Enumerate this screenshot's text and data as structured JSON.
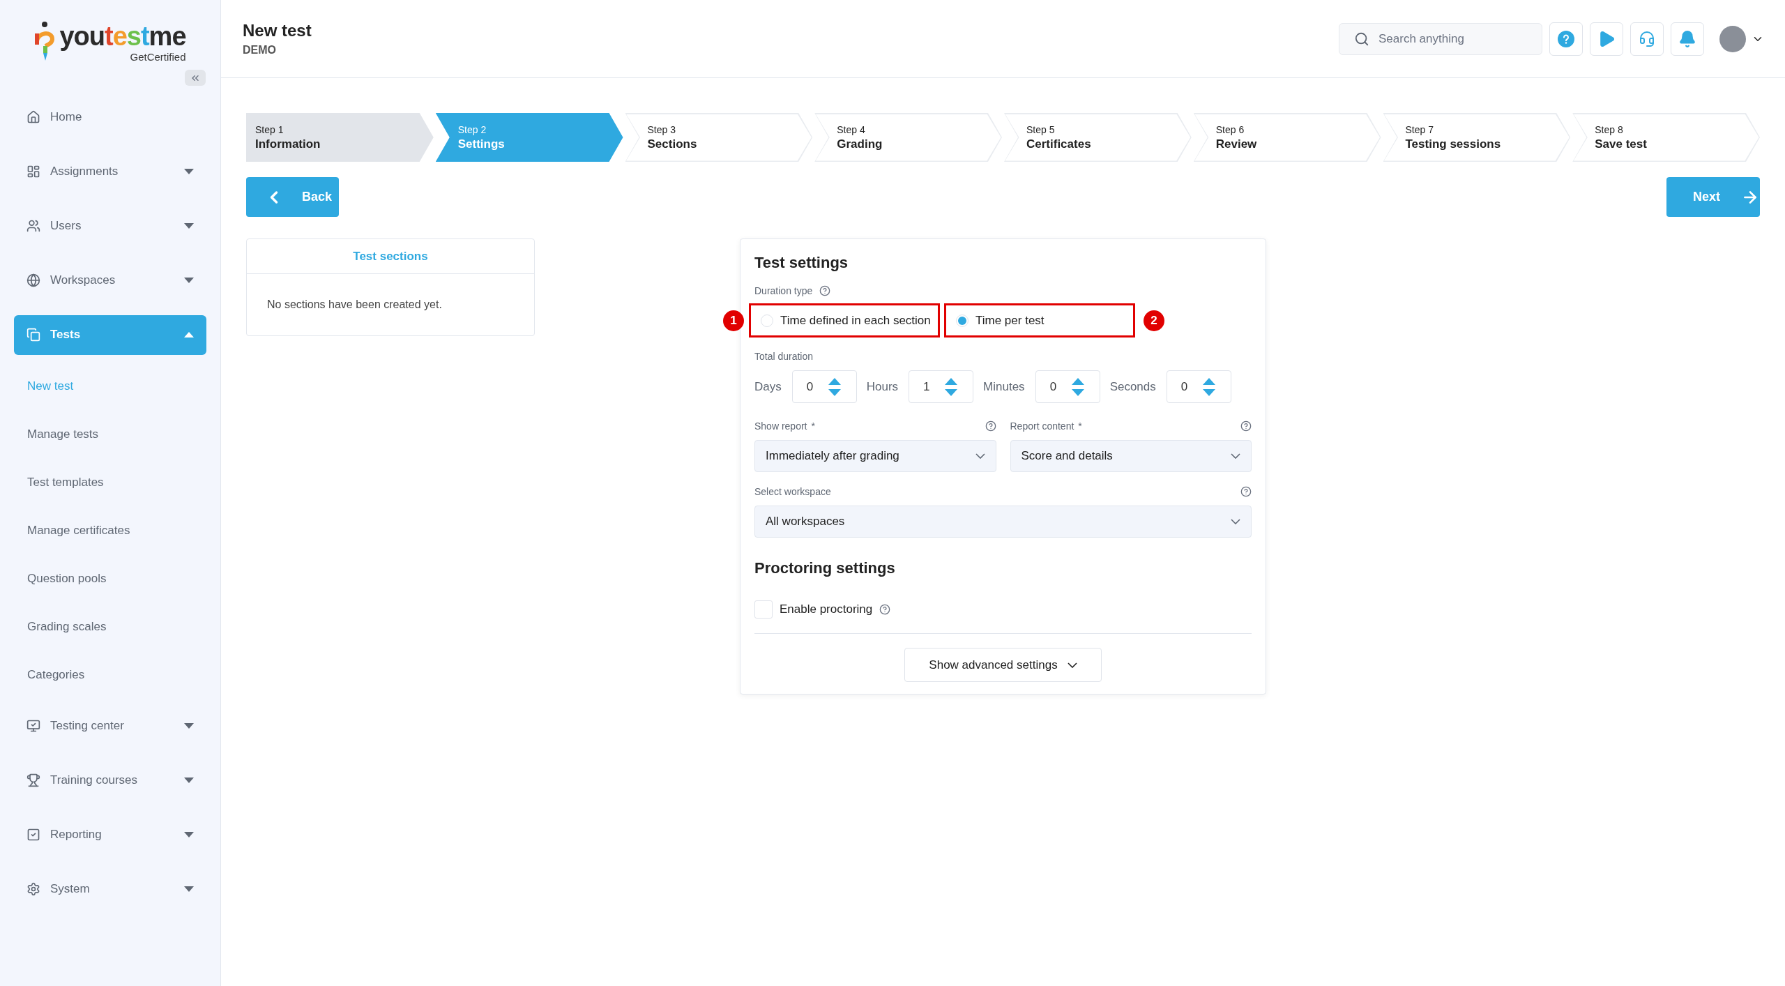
{
  "sidebar": {
    "logo": {
      "wordmark": "youtestme",
      "tagline": "GetCertified"
    },
    "items": [
      {
        "label": "Home",
        "kind": "link",
        "selected": false
      },
      {
        "label": "Assignments",
        "kind": "group",
        "selected": false,
        "expanded": false
      },
      {
        "label": "Users",
        "kind": "group",
        "selected": false,
        "expanded": false
      },
      {
        "label": "Workspaces",
        "kind": "group",
        "selected": false,
        "expanded": false
      },
      {
        "label": "Tests",
        "kind": "group",
        "selected": true,
        "expanded": true,
        "children": [
          {
            "label": "New test",
            "selected": true
          },
          {
            "label": "Manage tests",
            "selected": false
          },
          {
            "label": "Test templates",
            "selected": false
          },
          {
            "label": "Manage certificates",
            "selected": false
          },
          {
            "label": "Question pools",
            "selected": false
          },
          {
            "label": "Grading scales",
            "selected": false
          },
          {
            "label": "Categories",
            "selected": false
          }
        ]
      },
      {
        "label": "Testing center",
        "kind": "group",
        "selected": false,
        "expanded": false
      },
      {
        "label": "Training courses",
        "kind": "group",
        "selected": false,
        "expanded": false
      },
      {
        "label": "Reporting",
        "kind": "group",
        "selected": false,
        "expanded": false
      },
      {
        "label": "System",
        "kind": "group",
        "selected": false,
        "expanded": false
      }
    ]
  },
  "header": {
    "title": "New test",
    "subtitle": "DEMO",
    "search": {
      "placeholder": "Search anything"
    }
  },
  "steps": [
    {
      "step": "Step 1",
      "label": "Information",
      "selected": false,
      "completed": true
    },
    {
      "step": "Step 2",
      "label": "Settings",
      "selected": true,
      "completed": false
    },
    {
      "step": "Step 3",
      "label": "Sections",
      "selected": false,
      "completed": false
    },
    {
      "step": "Step 4",
      "label": "Grading",
      "selected": false,
      "completed": false
    },
    {
      "step": "Step 5",
      "label": "Certificates",
      "selected": false,
      "completed": false
    },
    {
      "step": "Step 6",
      "label": "Review",
      "selected": false,
      "completed": false
    },
    {
      "step": "Step 7",
      "label": "Testing sessions",
      "selected": false,
      "completed": false
    },
    {
      "step": "Step 8",
      "label": "Save test",
      "selected": false,
      "completed": false
    }
  ],
  "buttons": {
    "back": "Back",
    "next": "Next"
  },
  "sections_panel": {
    "tab": "Test sections",
    "empty_message": "No sections have been created yet."
  },
  "settings": {
    "title": "Test settings",
    "duration_type": {
      "label": "Duration type",
      "options": [
        {
          "label": "Time defined in each section",
          "selected": false,
          "callout": "1"
        },
        {
          "label": "Time per test",
          "selected": true,
          "callout": "2"
        }
      ]
    },
    "total_duration": {
      "label": "Total duration",
      "fields": [
        {
          "label": "Days",
          "value": "0"
        },
        {
          "label": "Hours",
          "value": "1"
        },
        {
          "label": "Minutes",
          "value": "0"
        },
        {
          "label": "Seconds",
          "value": "0"
        }
      ]
    },
    "show_report": {
      "label": "Show report",
      "required_mark": "*",
      "value": "Immediately after grading"
    },
    "report_content": {
      "label": "Report content",
      "required_mark": "*",
      "value": "Score and details"
    },
    "workspace": {
      "label": "Select workspace",
      "value": "All workspaces"
    },
    "proctoring": {
      "title": "Proctoring settings",
      "checkbox": {
        "label": "Enable proctoring",
        "checked": false
      }
    },
    "advanced_button": "Show advanced settings"
  }
}
